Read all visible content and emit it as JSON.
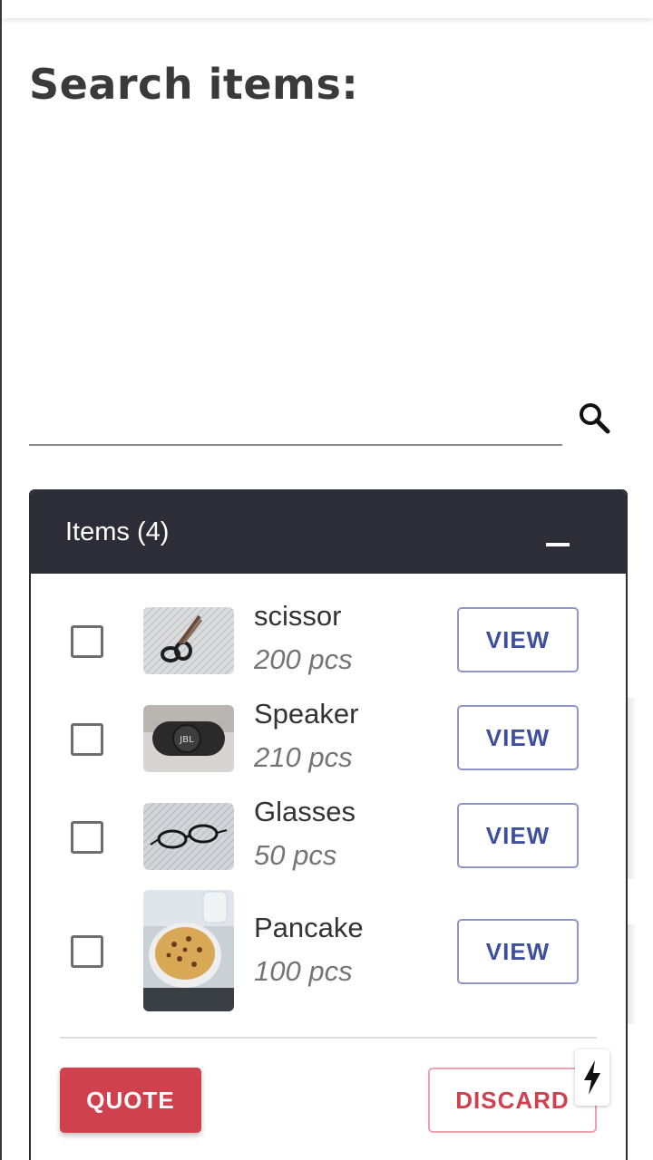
{
  "page": {
    "title": "Search items:"
  },
  "search": {
    "placeholder": "",
    "value": "",
    "icon": "search-icon"
  },
  "items_panel": {
    "title": "Items (4)",
    "collapse_icon": "minus-icon",
    "items": [
      {
        "name": "scissor",
        "quantity": "200 pcs",
        "view_label": "VIEW",
        "checked": false
      },
      {
        "name": "Speaker",
        "quantity": "210 pcs",
        "view_label": "VIEW",
        "checked": false
      },
      {
        "name": "Glasses",
        "quantity": "50 pcs",
        "view_label": "VIEW",
        "checked": false
      },
      {
        "name": "Pancake",
        "quantity": "100 pcs",
        "view_label": "VIEW",
        "checked": false
      }
    ],
    "quote_label": "QUOTE",
    "discard_label": "DISCARD"
  },
  "floating_action": {
    "icon": "lightning-icon"
  },
  "colors": {
    "header_bg": "#2d2d38",
    "view_text": "#3f4fa0",
    "view_border": "#8f97c9",
    "danger": "#d0414e",
    "danger_border": "#eaa3aa"
  }
}
